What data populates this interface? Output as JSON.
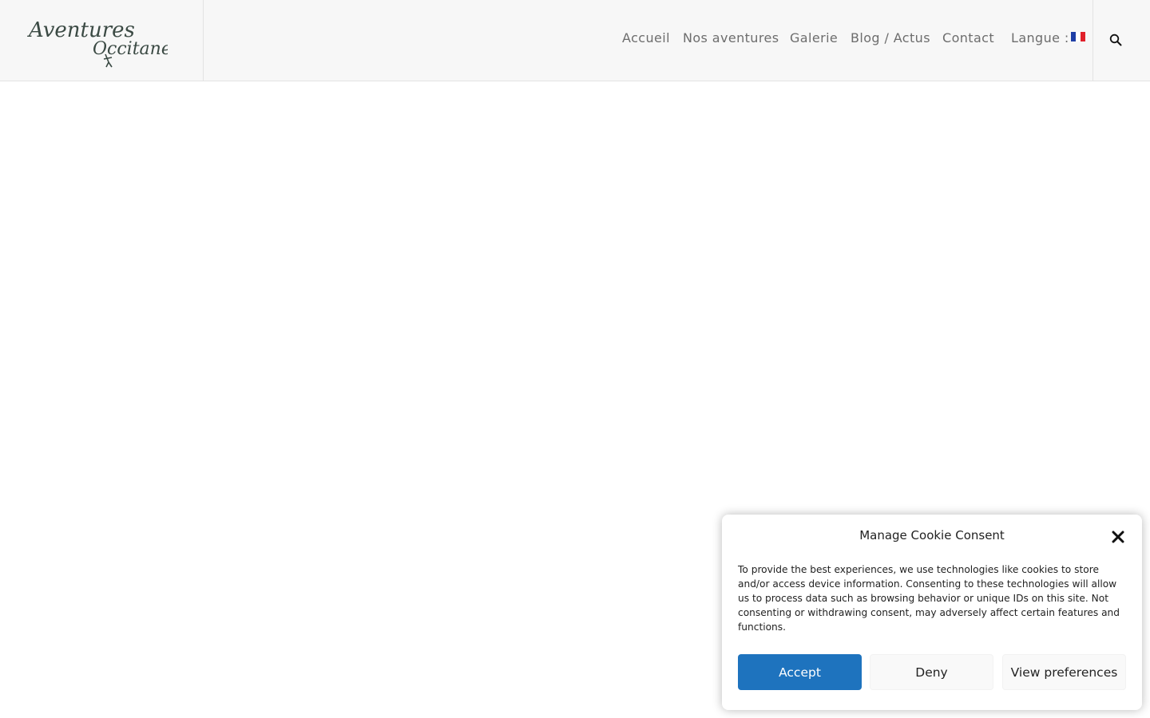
{
  "header": {
    "logo_text_line1": "Aventures",
    "logo_text_line2": "Occitanes",
    "nav": [
      {
        "label": "Accueil"
      },
      {
        "label": "Nos aventures"
      },
      {
        "label": "Galerie"
      },
      {
        "label": "Blog / Actus"
      },
      {
        "label": "Contact"
      }
    ],
    "language_label": "Langue :",
    "language_flag": "flag-france-icon"
  },
  "cookie_banner": {
    "title": "Manage Cookie Consent",
    "body": "To provide the best experiences, we use technologies like cookies to store and/or access device information. Consenting to these technologies will allow us to process data such as browsing behavior or unique IDs on this site. Not consenting or withdrawing consent, may adversely affect certain features and functions.",
    "accept_label": "Accept",
    "deny_label": "Deny",
    "preferences_label": "View preferences",
    "accent_color": "#1e73be"
  }
}
